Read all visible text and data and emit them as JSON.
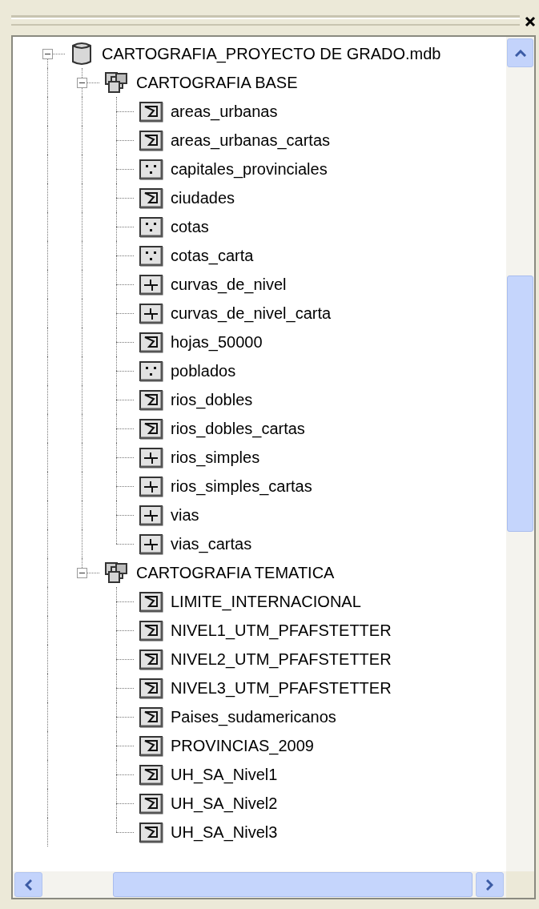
{
  "tree": [
    {
      "label": "CARTOGRAFIA_PROYECTO DE GRADO.mdb",
      "kind": "database",
      "expanded": true,
      "children": [
        {
          "label": "CARTOGRAFIA BASE",
          "kind": "dataset",
          "expanded": true,
          "children": [
            {
              "label": "areas_urbanas",
              "kind": "polygon"
            },
            {
              "label": "areas_urbanas_cartas",
              "kind": "polygon"
            },
            {
              "label": "capitales_provinciales",
              "kind": "point"
            },
            {
              "label": "ciudades",
              "kind": "polygon"
            },
            {
              "label": "cotas",
              "kind": "point"
            },
            {
              "label": "cotas_carta",
              "kind": "point"
            },
            {
              "label": "curvas_de_nivel",
              "kind": "line"
            },
            {
              "label": "curvas_de_nivel_carta",
              "kind": "line"
            },
            {
              "label": "hojas_50000",
              "kind": "polygon"
            },
            {
              "label": "poblados",
              "kind": "point"
            },
            {
              "label": "rios_dobles",
              "kind": "polygon"
            },
            {
              "label": "rios_dobles_cartas",
              "kind": "polygon"
            },
            {
              "label": "rios_simples",
              "kind": "line"
            },
            {
              "label": "rios_simples_cartas",
              "kind": "line"
            },
            {
              "label": "vias",
              "kind": "line"
            },
            {
              "label": "vias_cartas",
              "kind": "line"
            }
          ]
        },
        {
          "label": "CARTOGRAFIA TEMATICA",
          "kind": "dataset",
          "expanded": true,
          "children": [
            {
              "label": "LIMITE_INTERNACIONAL",
              "kind": "polygon"
            },
            {
              "label": "NIVEL1_UTM_PFAFSTETTER",
              "kind": "polygon"
            },
            {
              "label": "NIVEL2_UTM_PFAFSTETTER",
              "kind": "polygon"
            },
            {
              "label": "NIVEL3_UTM_PFAFSTETTER",
              "kind": "polygon"
            },
            {
              "label": "Paises_sudamericanos",
              "kind": "polygon"
            },
            {
              "label": "PROVINCIAS_2009",
              "kind": "polygon"
            },
            {
              "label": "UH_SA_Nivel1",
              "kind": "polygon"
            },
            {
              "label": "UH_SA_Nivel2",
              "kind": "polygon"
            },
            {
              "label": "UH_SA_Nivel3",
              "kind": "polygon"
            }
          ]
        }
      ]
    }
  ]
}
